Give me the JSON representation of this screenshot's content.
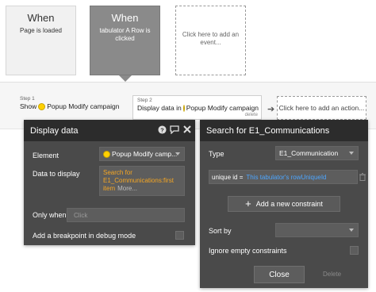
{
  "events": [
    {
      "title": "When",
      "subtitle": "Page is loaded"
    },
    {
      "title": "When",
      "subtitle": "tabulator A Row is clicked"
    },
    {
      "title": "",
      "subtitle": "Click here to add an event..."
    }
  ],
  "steps": {
    "step1": {
      "num": "Step 1",
      "prefix": "Show",
      "target": "Popup Modify campaign"
    },
    "step2": {
      "num": "Step 2",
      "prefix": "Display data in",
      "target": "Popup Modify campaign",
      "delete": "delete"
    },
    "add_action": "Click here to add an action..."
  },
  "display_panel": {
    "title": "Display data",
    "icons": [
      "help-icon",
      "comment-icon",
      "close-icon"
    ],
    "element_label": "Element",
    "element_value": "Popup Modify camp...",
    "data_label": "Data to display",
    "data_value": "Search for E1_Communications:first item",
    "data_more": "More...",
    "only_when_label": "Only when",
    "only_when_placeholder": "Click",
    "breakpoint_label": "Add a breakpoint in debug mode"
  },
  "search_panel": {
    "title": "Search for E1_Communications",
    "type_label": "Type",
    "type_value": "E1_Communication",
    "constraint_key": "unique id =",
    "constraint_value": "This tabulator's rowUniqueId",
    "add_constraint": "Add a new constraint",
    "sort_label": "Sort by",
    "sort_value": "",
    "ignore_label": "Ignore empty constraints",
    "close_label": "Close",
    "delete_label": "Delete"
  },
  "colors": {
    "highlight": "#f5a623",
    "link": "#4da6ff",
    "dot": "#ffd000"
  }
}
